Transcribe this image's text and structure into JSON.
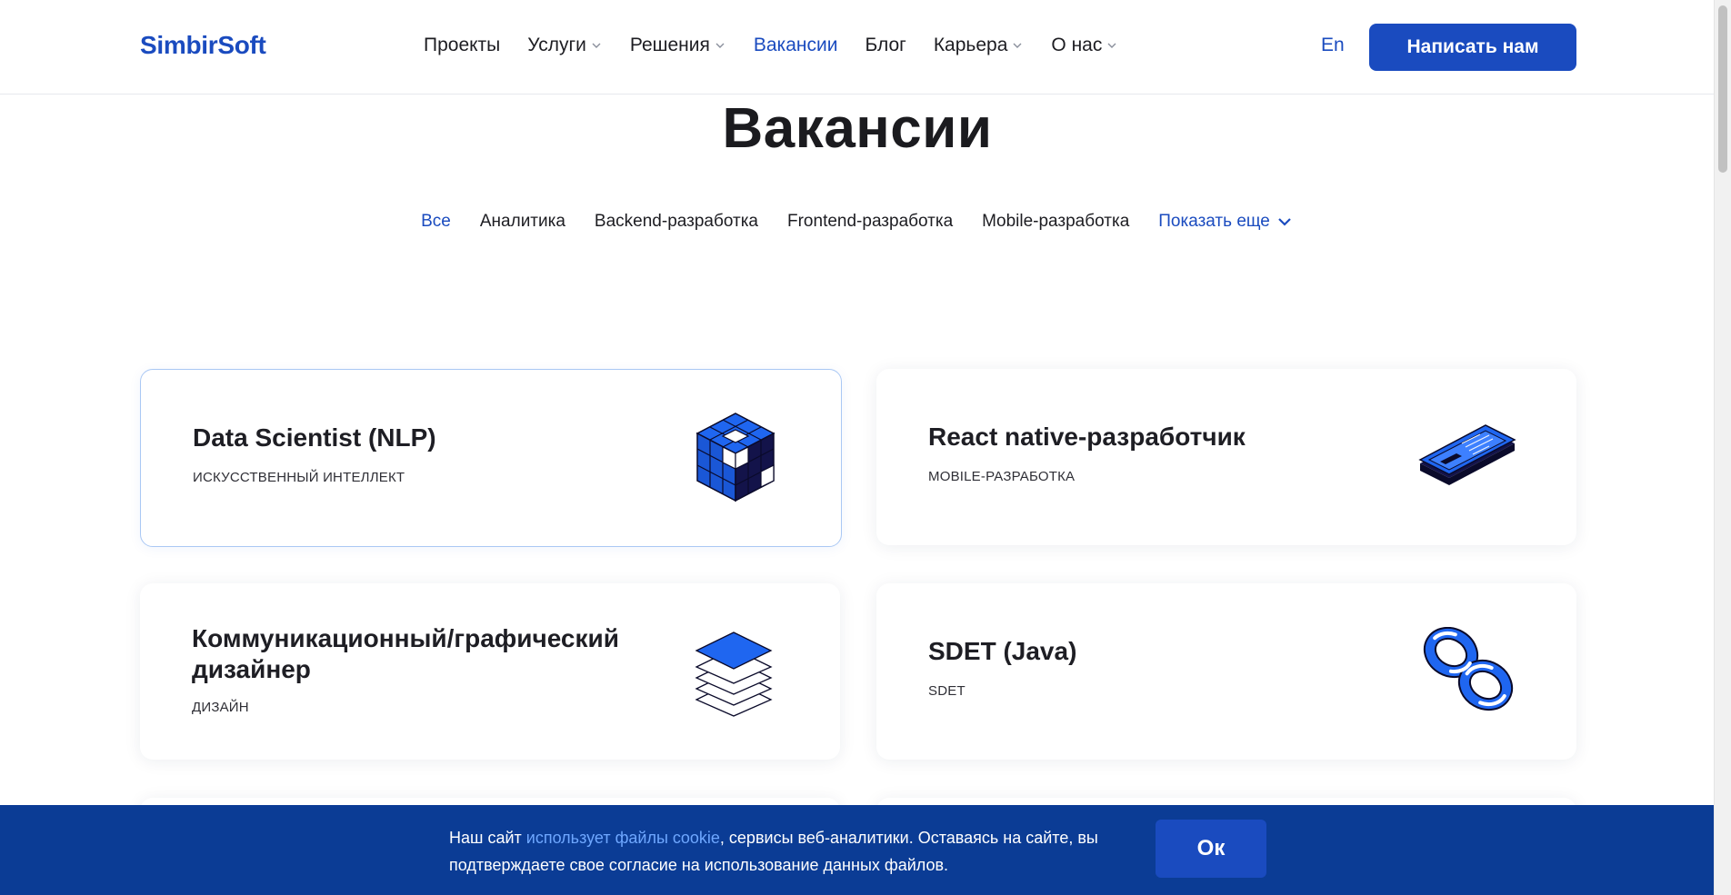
{
  "header": {
    "logo": "SimbirSoft",
    "nav": [
      {
        "label": "Проекты",
        "dropdown": false
      },
      {
        "label": "Услуги",
        "dropdown": true
      },
      {
        "label": "Решения",
        "dropdown": true
      },
      {
        "label": "Вакансии",
        "dropdown": false,
        "active": true
      },
      {
        "label": "Блог",
        "dropdown": false
      },
      {
        "label": "Карьера",
        "dropdown": true
      },
      {
        "label": "О нас",
        "dropdown": true
      }
    ],
    "lang": "En",
    "cta": "Написать нам"
  },
  "page": {
    "title": "Вакансии",
    "filters": [
      "Все",
      "Аналитика",
      "Backend-разработка",
      "Frontend-разработка",
      "Mobile-разработка"
    ],
    "more": "Показать еще"
  },
  "vacancies": [
    {
      "title": "Data Scientist (NLP)",
      "category": "ИСКУССТВЕННЫЙ ИНТЕЛЛЕКТ",
      "icon": "cube-icon"
    },
    {
      "title": "React native-разработчик",
      "category": "MOBILE-РАЗРАБОТКА",
      "icon": "smartphone-icon"
    },
    {
      "title": "Коммуникационный/графический дизайнер",
      "category": "ДИЗАЙН",
      "icon": "layers-icon"
    },
    {
      "title": "SDET (Java)",
      "category": "SDET",
      "icon": "infinity-icon"
    }
  ],
  "cookie": {
    "text_before": "Наш сайт ",
    "link": "использует файлы cookie",
    "text_after": ", сервисы веб-аналитики. Оставаясь на сайте, вы подтверждаете свое согласие на использование данных файлов.",
    "ok": "Ок"
  },
  "colors": {
    "accent": "#1a4bbf",
    "banner": "#0b3c95",
    "text": "#1b1b1f"
  }
}
